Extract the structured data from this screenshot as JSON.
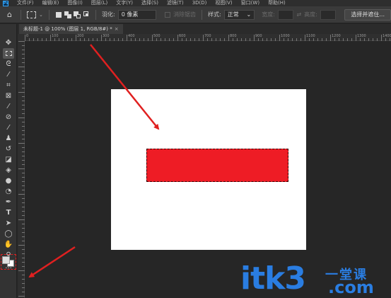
{
  "menubar": {
    "logo": "Ps",
    "items": [
      "文件(F)",
      "编辑(E)",
      "图像(I)",
      "图层(L)",
      "文字(Y)",
      "选择(S)",
      "滤镜(T)",
      "3D(D)",
      "视图(V)",
      "窗口(W)",
      "帮助(H)"
    ]
  },
  "options": {
    "feather_label": "羽化:",
    "feather_value": "0 像素",
    "antialias_label": "消除锯齿",
    "style_label": "样式:",
    "style_value": "正常",
    "width_label": "宽度:",
    "height_label": "高度:",
    "select_mask_button": "选择并遮住..."
  },
  "document": {
    "tab_title": "未标题-1 @ 100% (图层 1, RGB/8#) *",
    "tab_close": "×"
  },
  "ruler": {
    "labels": [
      "0",
      "100",
      "200",
      "300",
      "400",
      "500",
      "600",
      "700",
      "800",
      "900",
      "1000",
      "1100",
      "1200",
      "1300",
      "1400"
    ]
  },
  "colors": {
    "selection_fill": "#ee1c25",
    "canvas": "#ffffff",
    "arrow": "#e02020",
    "watermark": "#2a7de1"
  },
  "icons": [
    "home-icon",
    "move-icon",
    "marquee-icon",
    "lasso-icon",
    "quick-select-icon",
    "crop-icon",
    "frame-icon",
    "eyedropper-icon",
    "healing-icon",
    "brush-icon",
    "stamp-icon",
    "history-brush-icon",
    "eraser-icon",
    "gradient-icon",
    "blur-icon",
    "dodge-icon",
    "pen-icon",
    "type-icon",
    "path-select-icon",
    "ellipse-icon",
    "hand-icon",
    "zoom-icon",
    "more-icon"
  ],
  "watermark": {
    "brand": "itk3",
    "cn": "一堂课",
    "domain": ".com"
  }
}
